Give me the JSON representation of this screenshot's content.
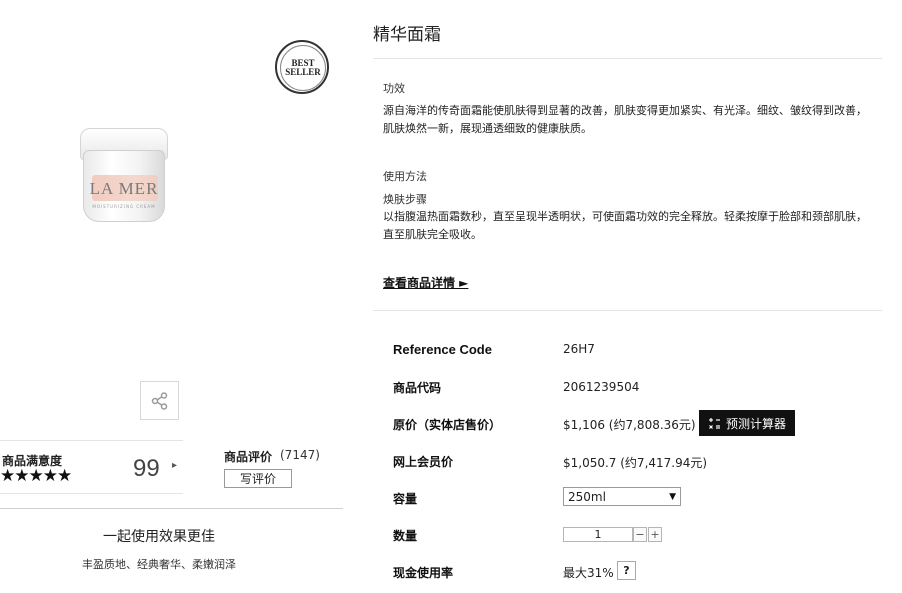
{
  "product": {
    "image_brand": "LA MER",
    "image_subtext": "MOISTURIZING CREAM",
    "badge_line1": "BEST",
    "badge_line2": "SELLER"
  },
  "rating": {
    "label": "商品满意度",
    "stars": "★★★★★",
    "stars_value": 5,
    "score": "99",
    "chevron": "▸"
  },
  "reviews": {
    "label": "商品评价",
    "count": "(7147)",
    "write_button": "写评价"
  },
  "pairing": {
    "title": "一起使用效果更佳",
    "description": "丰盈质地、经典奢华、柔嫩润泽"
  },
  "title": "精华面霜",
  "efficacy": {
    "heading": "功效",
    "text": "源自海洋的传奇面霜能使肌肤得到显著的改善，肌肤变得更加紧实、有光泽。细纹、皱纹得到改善，肌肤焕然一新，展现通透细致的健康肤质。"
  },
  "usage": {
    "heading": "使用方法",
    "subheading": "焕肤步骤",
    "text": "以指腹温热面霜数秒，直至呈现半透明状，可使面霜功效的完全释放。轻柔按摩于脸部和颈部肌肤，直至肌肤完全吸收。"
  },
  "view_details": "查看商品详情 ►",
  "details": {
    "reference_label": "Reference Code",
    "reference_value": "26H7",
    "code_label": "商品代码",
    "code_value": "2061239504",
    "original_price_label": "原价（实体店售价）",
    "original_price_value": "$1,106 (约7,808.36元)",
    "calculator_button": "预测计算器",
    "member_price_label": "网上会员价",
    "member_price_value": "$1,050.7 (约7,417.94元)",
    "size_label": "容量",
    "size_value": "250ml",
    "quantity_label": "数量",
    "quantity_value": "1",
    "quantity_minus": "−",
    "quantity_plus": "+",
    "cash_label": "现金使用率",
    "cash_value": "最大31%",
    "cash_help": "?"
  },
  "icons": {
    "share": "share-icon",
    "calculator": "calculator-icon",
    "dropdown": "triangle-down-icon"
  },
  "colors": {
    "calculator_bg": "#111111",
    "label_pink": "#f1cbbf"
  }
}
